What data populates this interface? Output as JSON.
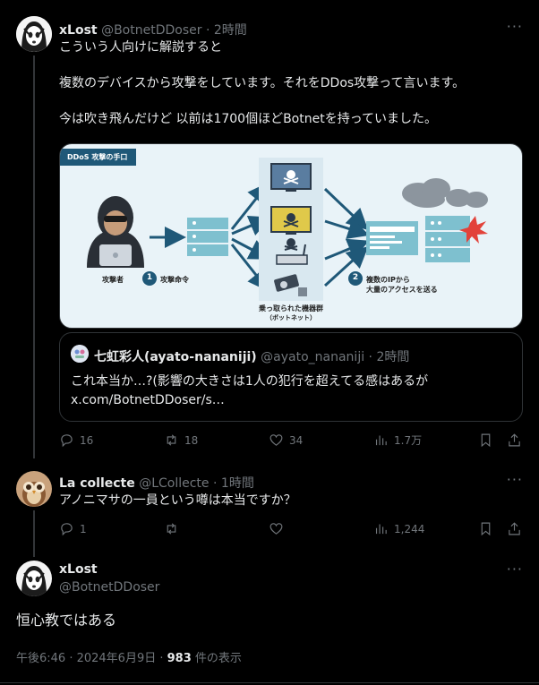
{
  "tweet1": {
    "name": "xLost",
    "handle": "@BotnetDDoser",
    "time": "2時間",
    "text": "こういう人向けに解説すると\n\n複数のデバイスから攻撃をしています。それをDDos攻撃って言います。\n\n今は吹き飛んだけど 以前は1700個ほどBotnetを持っていました。",
    "media": {
      "tag": "DDoS 攻撃の手口",
      "attacker_label": "攻撃者",
      "step1_num": "1",
      "step1_label": "攻撃命令",
      "devices_label": "乗っ取られた機器群",
      "devices_sublabel": "（ボットネット）",
      "step2_num": "2",
      "step2_label_line1": "複数のIPから",
      "step2_label_line2": "大量のアクセスを送る"
    },
    "quote": {
      "name": "七虹彩人(ayato-nananiji)",
      "handle": "@ayato_nananiji",
      "time": "2時間",
      "text_line1": "これ本当か…?(影響の大きさは1人の犯行を超えてる感はあるが",
      "text_line2": "x.com/BotnetDDoser/s…"
    },
    "stats": {
      "replies": "16",
      "reposts": "18",
      "likes": "34",
      "views": "1.7万"
    }
  },
  "tweet2": {
    "name": "La collecte",
    "handle": "@LCollecte",
    "time": "1時間",
    "text": "アノニマサの一員という噂は本当ですか？",
    "stats": {
      "replies": "1",
      "reposts": "",
      "likes": "",
      "views": "1,244"
    }
  },
  "tweet3": {
    "name": "xLost",
    "handle": "@BotnetDDoser",
    "text": "恒心教ではある",
    "timestamp": "午後6:46 · 2024年6月9日 · ",
    "view_count": "983",
    "view_suffix": " 件の表示"
  },
  "separator": " · ",
  "more_glyph": "···",
  "colors": {
    "background": "#000000",
    "text": "#e7e9ea",
    "secondary": "#71767b",
    "border": "#2f3336",
    "media_navy": "#1f5878"
  },
  "icons": [
    "reply-icon",
    "repost-icon",
    "like-icon",
    "views-icon",
    "bookmark-icon",
    "share-icon",
    "more-icon"
  ]
}
